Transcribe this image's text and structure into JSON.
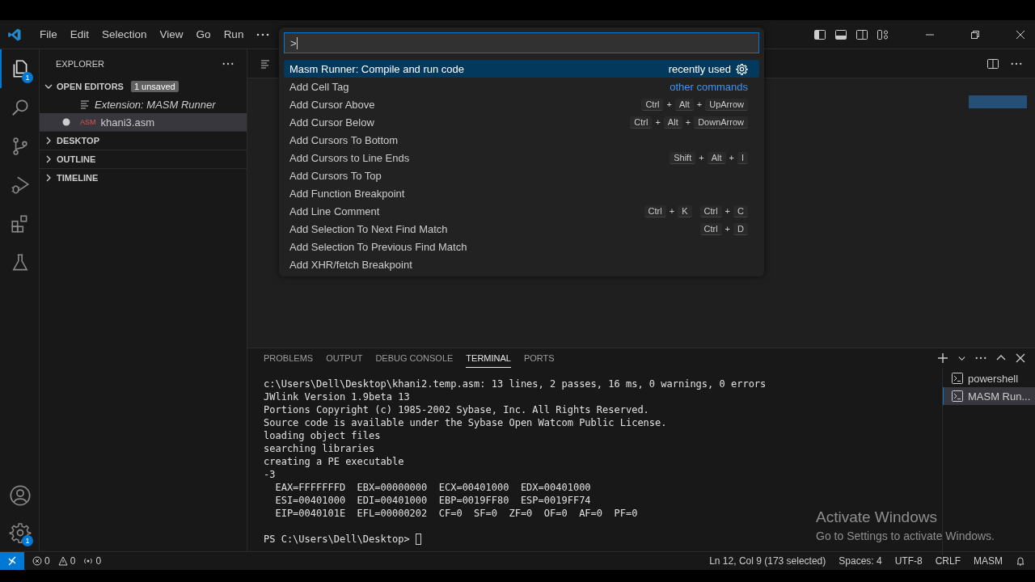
{
  "window": {
    "menu": [
      "File",
      "Edit",
      "Selection",
      "View",
      "Go",
      "Run"
    ]
  },
  "activity_bar": {
    "items": [
      {
        "kind": "explorer",
        "selected": true,
        "badge": "1"
      },
      {
        "kind": "search",
        "selected": false
      },
      {
        "kind": "source-control",
        "selected": false
      },
      {
        "kind": "run-debug",
        "selected": false
      },
      {
        "kind": "extensions",
        "selected": false
      },
      {
        "kind": "testing",
        "selected": false
      }
    ],
    "bottom": [
      {
        "kind": "account"
      },
      {
        "kind": "settings",
        "badge": "1"
      }
    ]
  },
  "sidebar": {
    "title": "EXPLORER",
    "sections": [
      {
        "title": "OPEN EDITORS",
        "expanded": true,
        "badge": "1 unsaved",
        "items": [
          {
            "name": "Extension: MASM Runner",
            "kind": "preview",
            "selected": false,
            "unsaved": false
          },
          {
            "name": "khani3.asm",
            "kind": "asm",
            "icon_text": "ASM",
            "selected": true,
            "unsaved": true
          }
        ]
      },
      {
        "title": "DESKTOP",
        "expanded": false
      },
      {
        "title": "OUTLINE",
        "expanded": false
      },
      {
        "title": "TIMELINE",
        "expanded": false
      }
    ]
  },
  "command_palette": {
    "value": ">",
    "rows": [
      {
        "label": "Masm Runner: Compile and run code",
        "selected": true,
        "tag": {
          "kind": "recent",
          "text": "recently used"
        }
      },
      {
        "label": "Add Cell Tag",
        "selected": false,
        "tag": {
          "kind": "group",
          "text": "other commands"
        }
      },
      {
        "label": "Add Cursor Above",
        "selected": false,
        "keys": [
          [
            "Ctrl",
            "+",
            "Alt",
            "+",
            "UpArrow"
          ]
        ]
      },
      {
        "label": "Add Cursor Below",
        "selected": false,
        "keys": [
          [
            "Ctrl",
            "+",
            "Alt",
            "+",
            "DownArrow"
          ]
        ]
      },
      {
        "label": "Add Cursors To Bottom",
        "selected": false
      },
      {
        "label": "Add Cursors to Line Ends",
        "selected": false,
        "keys": [
          [
            "Shift",
            "+",
            "Alt",
            "+",
            "I"
          ]
        ]
      },
      {
        "label": "Add Cursors To Top",
        "selected": false
      },
      {
        "label": "Add Function Breakpoint",
        "selected": false
      },
      {
        "label": "Add Line Comment",
        "selected": false,
        "keys": [
          [
            "Ctrl",
            "+",
            "K"
          ],
          [
            "Ctrl",
            "+",
            "C"
          ]
        ]
      },
      {
        "label": "Add Selection To Next Find Match",
        "selected": false,
        "keys": [
          [
            "Ctrl",
            "+",
            "D"
          ]
        ]
      },
      {
        "label": "Add Selection To Previous Find Match",
        "selected": false
      },
      {
        "label": "Add XHR/fetch Breakpoint",
        "selected": false
      }
    ]
  },
  "panel": {
    "tabs": [
      {
        "label": "PROBLEMS",
        "selected": false
      },
      {
        "label": "OUTPUT",
        "selected": false
      },
      {
        "label": "DEBUG CONSOLE",
        "selected": false
      },
      {
        "label": "TERMINAL",
        "selected": true
      },
      {
        "label": "PORTS",
        "selected": false
      }
    ],
    "terminal_lines": [
      "c:\\Users\\Dell\\Desktop\\khani2.temp.asm: 13 lines, 2 passes, 16 ms, 0 warnings, 0 errors",
      "JWlink Version 1.9beta 13",
      "Portions Copyright (c) 1985-2002 Sybase, Inc. All Rights Reserved.",
      "Source code is available under the Sybase Open Watcom Public License.",
      "loading object files",
      "searching libraries",
      "creating a PE executable",
      "-3",
      "  EAX=FFFFFFFD  EBX=00000000  ECX=00401000  EDX=00401000",
      "  ESI=00401000  EDI=00401000  EBP=0019FF80  ESP=0019FF74",
      "  EIP=0040101E  EFL=00000202  CF=0  SF=0  ZF=0  OF=0  AF=0  PF=0"
    ],
    "prompt": "PS C:\\Users\\Dell\\Desktop> ",
    "terminals": [
      {
        "name": "powershell",
        "selected": false
      },
      {
        "name": "MASM Run...",
        "selected": true
      }
    ]
  },
  "status_bar": {
    "left": [
      {
        "kind": "errors",
        "text": "0"
      },
      {
        "kind": "warnings",
        "text": "0"
      },
      {
        "kind": "ports",
        "text": "0"
      }
    ],
    "right": [
      "Ln 12, Col 9 (173 selected)",
      "Spaces: 4",
      "UTF-8",
      "CRLF",
      "MASM"
    ]
  },
  "activation": {
    "title": "Activate Windows",
    "message": "Go to Settings to activate Windows."
  }
}
